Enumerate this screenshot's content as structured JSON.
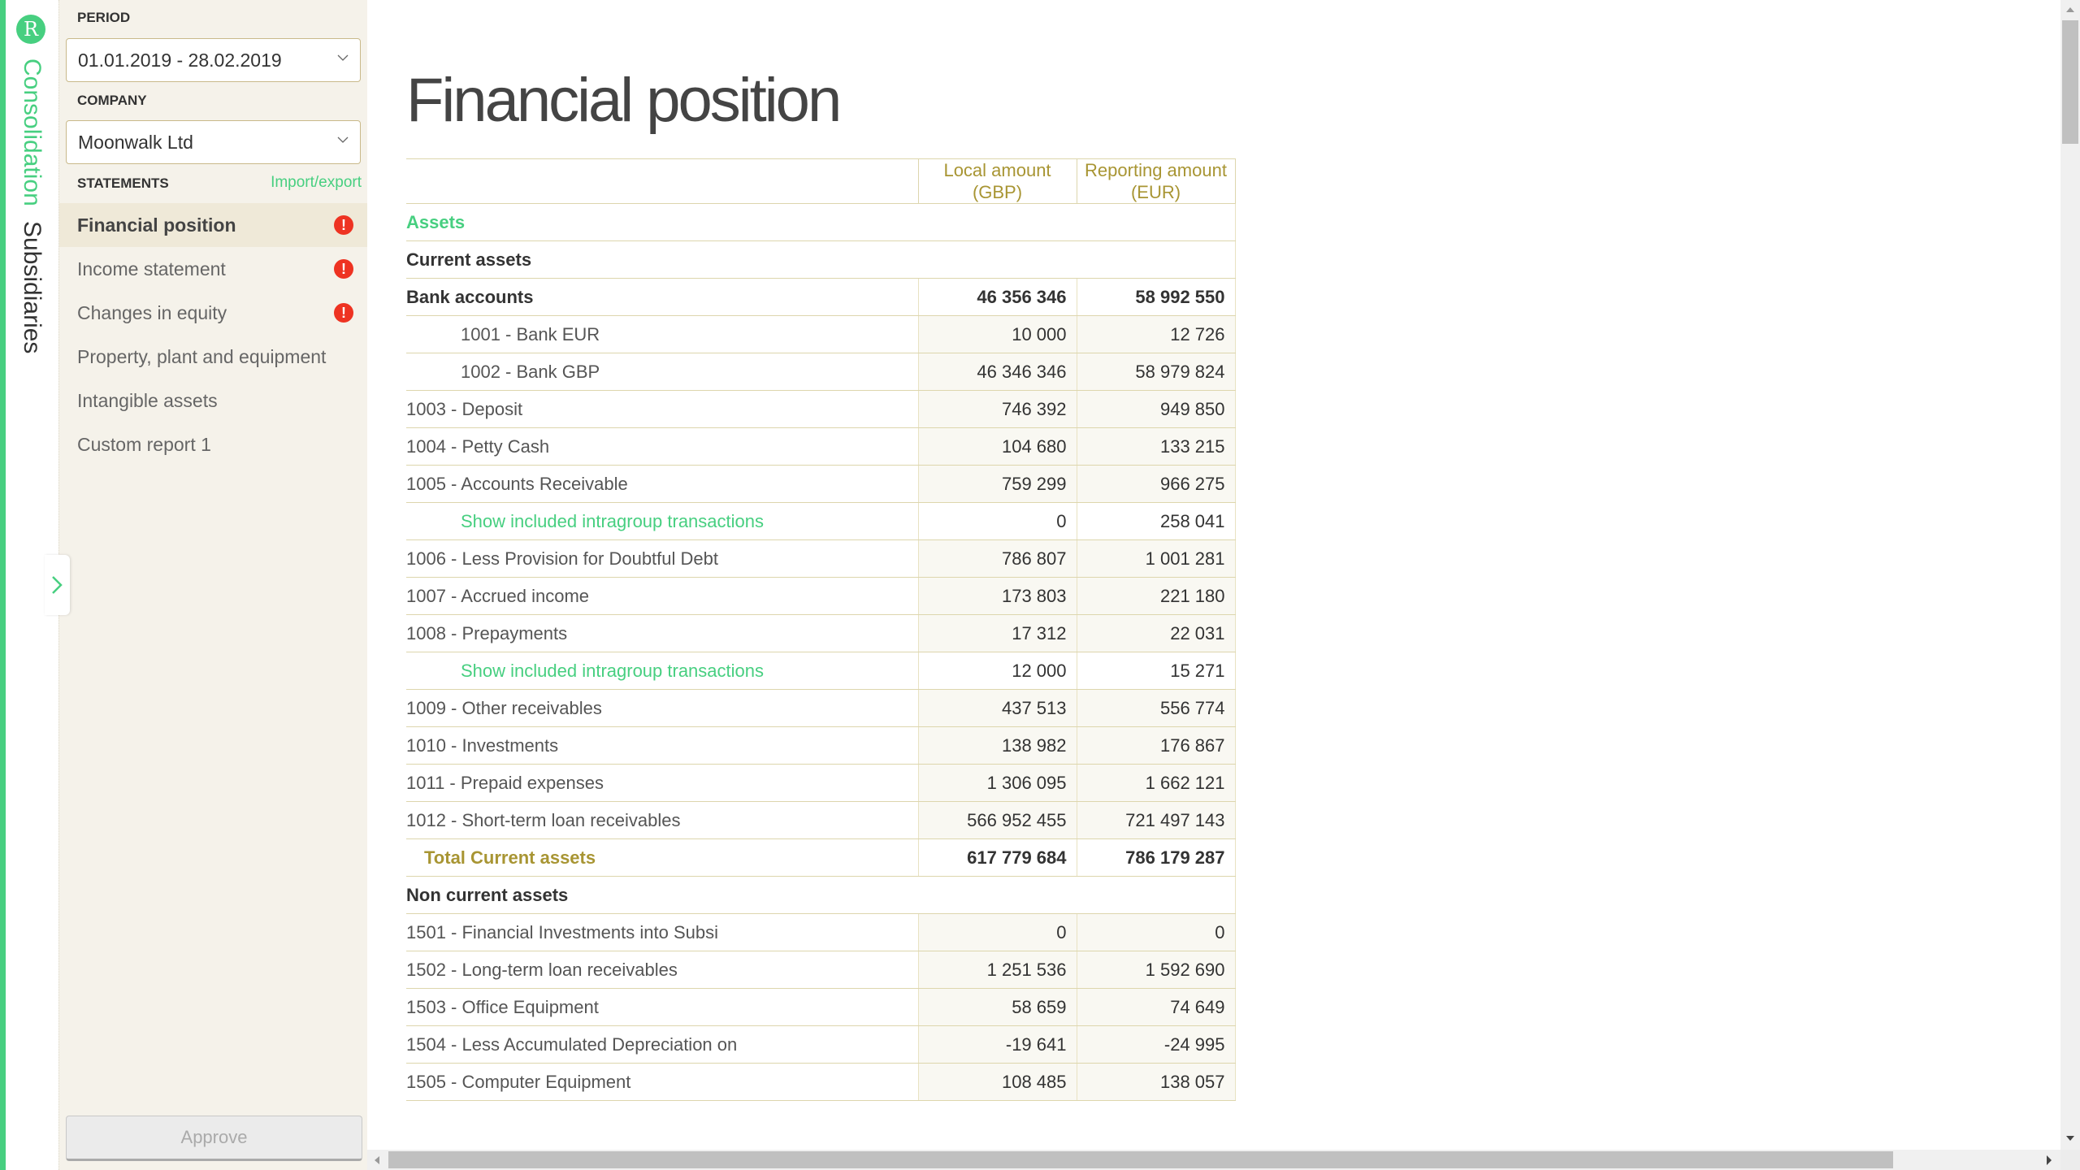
{
  "rail": {
    "logo_letter": "R",
    "consolidation_label": "Consolidation",
    "subsidiaries_label": "Subsidiaries"
  },
  "sidebar": {
    "period_label": "PERIOD",
    "period_value": "01.01.2019 - 28.02.2019",
    "company_label": "COMPANY",
    "company_value": "Moonwalk Ltd",
    "statements_label": "STATEMENTS",
    "import_export_label": "Import/export",
    "items": [
      {
        "label": "Financial position",
        "alert": "!",
        "active": true
      },
      {
        "label": "Income statement",
        "alert": "!"
      },
      {
        "label": "Changes in equity",
        "alert": "!"
      },
      {
        "label": "Property, plant and equipment"
      },
      {
        "label": "Intangible assets"
      },
      {
        "label": "Custom report 1"
      }
    ],
    "approve_label": "Approve"
  },
  "main": {
    "title": "Financial position",
    "columns": {
      "local_line1": "Local amount",
      "local_line2": "(GBP)",
      "reporting_line1": "Reporting amount",
      "reporting_line2": "(EUR)"
    },
    "assets_heading": "Assets",
    "current_assets_heading": "Current assets",
    "rows": [
      {
        "name": "Bank accounts",
        "local": "46 356 346",
        "reporting": "58 992 550"
      },
      {
        "name": "1001 - Bank EUR",
        "local": "10 000",
        "reporting": "12 726"
      },
      {
        "name": "1002 - Bank GBP",
        "local": "46 346 346",
        "reporting": "58 979 824"
      },
      {
        "name": "1003 - Deposit",
        "local": "746 392",
        "reporting": "949 850"
      },
      {
        "name": "1004 - Petty Cash",
        "local": "104 680",
        "reporting": "133 215"
      },
      {
        "name": "1005 - Accounts Receivable",
        "local": "759 299",
        "reporting": "966 275"
      },
      {
        "name": "Show included intragroup transactions",
        "local": "0",
        "reporting": "258 041"
      },
      {
        "name": "1006 - Less Provision for Doubtful Debt",
        "local": "786 807",
        "reporting": "1 001 281"
      },
      {
        "name": "1007 - Accrued income",
        "local": "173 803",
        "reporting": "221 180"
      },
      {
        "name": "1008 - Prepayments",
        "local": "17 312",
        "reporting": "22 031"
      },
      {
        "name": "Show included intragroup transactions",
        "local": "12 000",
        "reporting": "15 271"
      },
      {
        "name": "1009 - Other receivables",
        "local": "437 513",
        "reporting": "556 774"
      },
      {
        "name": "1010 - Investments",
        "local": "138 982",
        "reporting": "176 867"
      },
      {
        "name": "1011 - Prepaid expenses",
        "local": "1 306 095",
        "reporting": "1 662 121"
      },
      {
        "name": "1012 - Short-term loan receivables",
        "local": "566 952 455",
        "reporting": "721 497 143"
      },
      {
        "name": "Total Current assets",
        "local": "617 779 684",
        "reporting": "786 179 287"
      }
    ],
    "non_current_assets_heading": "Non current assets",
    "non_current_rows": [
      {
        "name": "1501 - Financial Investments into Subsi",
        "local": "0",
        "reporting": "0"
      },
      {
        "name": "1502 - Long-term loan receivables",
        "local": "1 251 536",
        "reporting": "1 592 690"
      },
      {
        "name": "1503 - Office Equipment",
        "local": "58 659",
        "reporting": "74 649"
      },
      {
        "name": "1504 - Less Accumulated Depreciation on",
        "local": "-19 641",
        "reporting": "-24 995"
      },
      {
        "name": "1505 - Computer Equipment",
        "local": "108 485",
        "reporting": "138 057"
      }
    ]
  },
  "colors": {
    "brand_green": "#47cf80",
    "gold": "#a89533",
    "alert_red": "#ee3322",
    "sidebar_bg": "#f5f2ea"
  }
}
